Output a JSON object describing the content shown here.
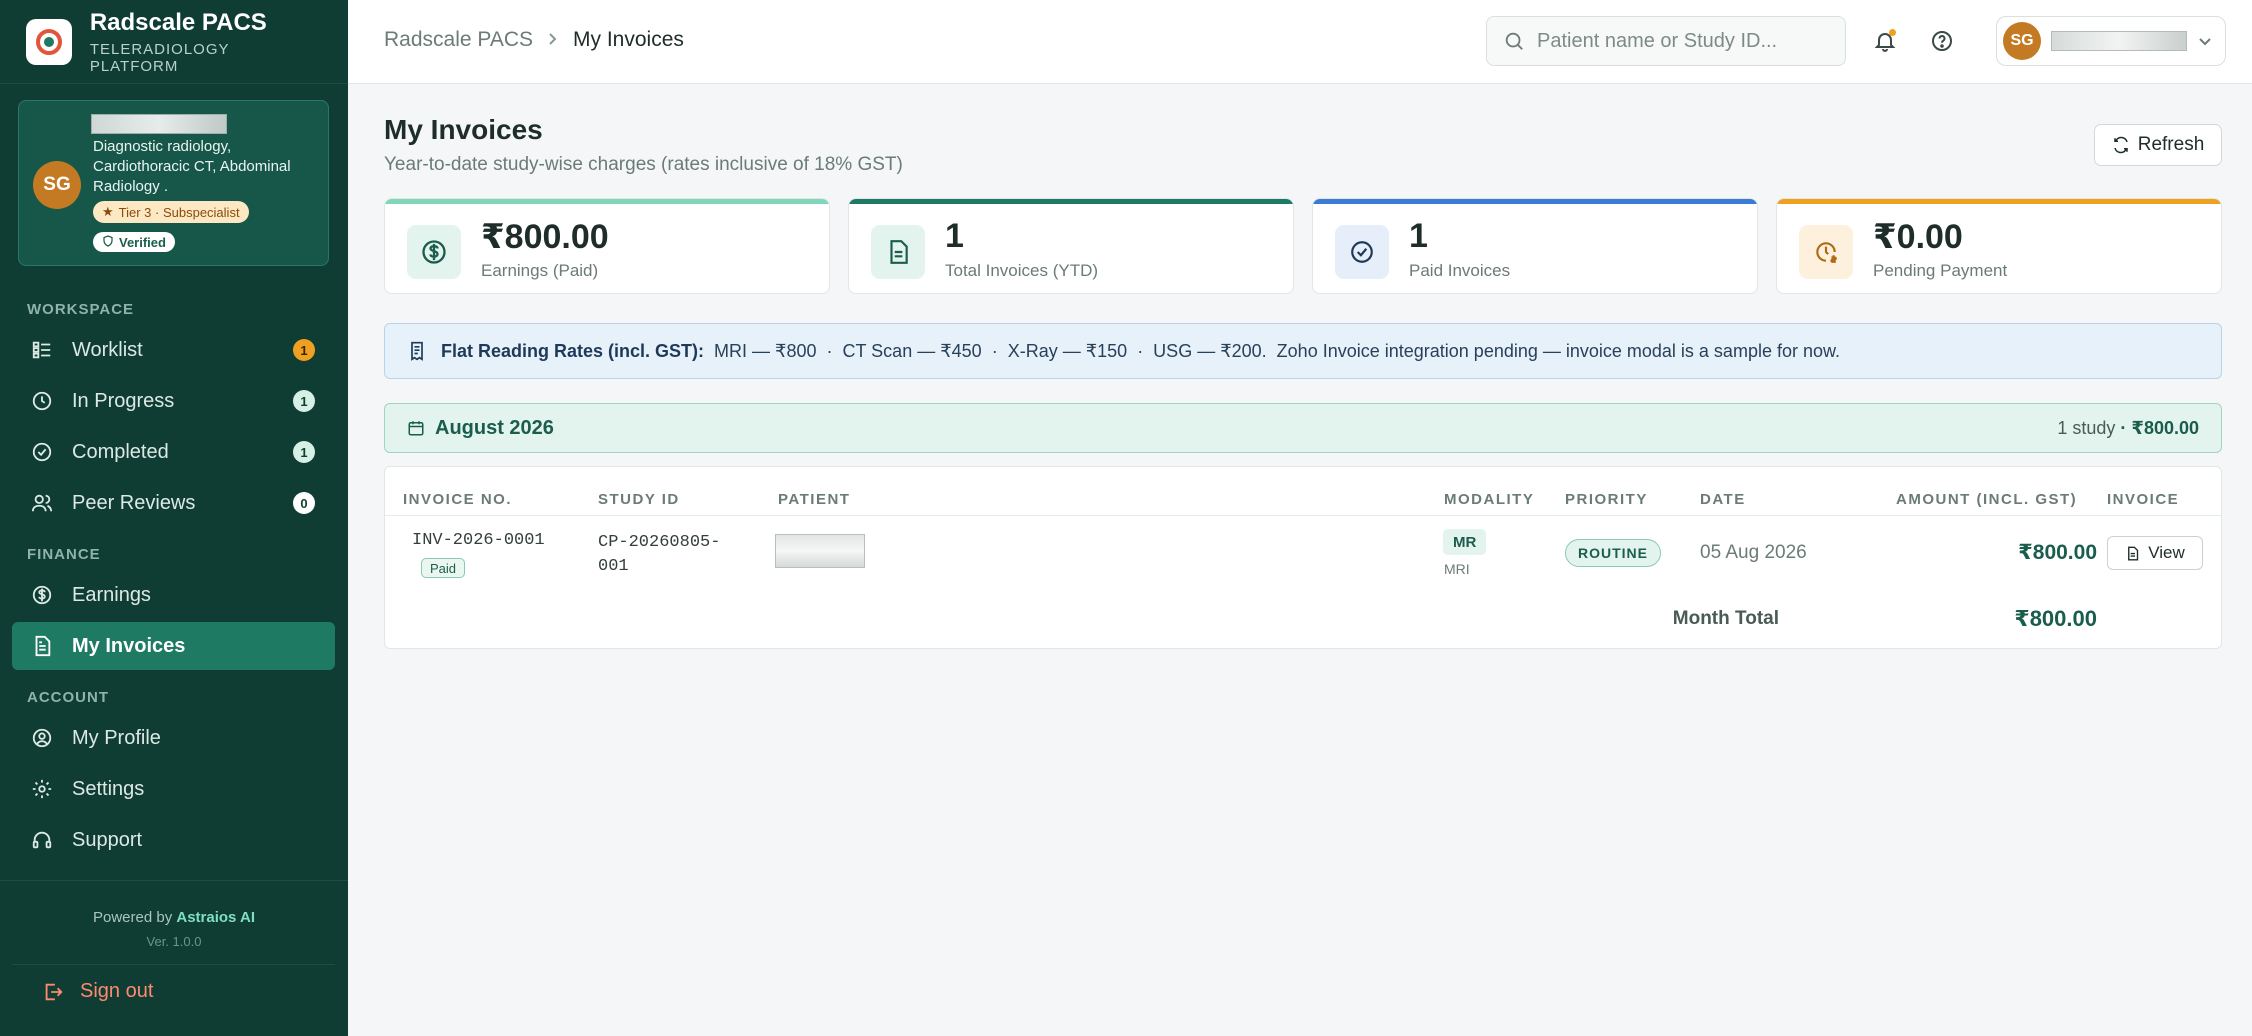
{
  "brand": {
    "title": "Radscale PACS",
    "subtitle": "TELERADIOLOGY PLATFORM"
  },
  "profile": {
    "initials": "SG",
    "specialty": "Diagnostic radiology, Cardiothoracic CT, Abdominal Radiology .",
    "tier": "Tier 3 · Subspecialist",
    "verified": "Verified"
  },
  "nav": {
    "workspace_label": "WORKSPACE",
    "finance_label": "FINANCE",
    "account_label": "ACCOUNT",
    "items": [
      {
        "label": "Worklist",
        "badge": "1"
      },
      {
        "label": "In Progress",
        "badge": "1"
      },
      {
        "label": "Completed",
        "badge": "1"
      },
      {
        "label": "Peer Reviews",
        "badge": "0"
      },
      {
        "label": "Earnings"
      },
      {
        "label": "My Invoices"
      },
      {
        "label": "My Profile"
      },
      {
        "label": "Settings"
      },
      {
        "label": "Support"
      }
    ]
  },
  "footer": {
    "powered_prefix": "Powered by",
    "powered_brand": "Astraios AI",
    "version": "Ver. 1.0.0",
    "signout": "Sign out"
  },
  "breadcrumb": {
    "root": "Radscale PACS",
    "current": "My Invoices"
  },
  "search": {
    "placeholder": "Patient name or Study ID..."
  },
  "user": {
    "initials": "SG"
  },
  "page": {
    "title": "My Invoices",
    "subtitle": "Year-to-date study-wise charges (rates inclusive of 18% GST)",
    "refresh": "Refresh"
  },
  "stats": [
    {
      "value": "₹800.00",
      "label": "Earnings (Paid)"
    },
    {
      "value": "1",
      "label": "Total Invoices (YTD)"
    },
    {
      "value": "1",
      "label": "Paid Invoices"
    },
    {
      "value": "₹0.00",
      "label": "Pending Payment"
    }
  ],
  "rates": {
    "title": "Flat Reading Rates (incl. GST):",
    "text": "MRI — ₹800  ·  CT Scan — ₹450  ·  X-Ray — ₹150  ·  USG — ₹200.  Zoho Invoice integration pending — invoice modal is a sample for now."
  },
  "month": {
    "title": "August 2026",
    "count": "1 study",
    "total": "· ₹800.00"
  },
  "table": {
    "headers": [
      "INVOICE NO.",
      "STUDY ID",
      "PATIENT",
      "MODALITY",
      "PRIORITY",
      "DATE",
      "AMOUNT (INCL. GST)",
      "INVOICE"
    ],
    "rows": [
      {
        "invoice_no": "INV-2026-0001",
        "status": "Paid",
        "study_id_line1": "CP-20260805-",
        "study_id_line2": "001",
        "modality_code": "MR",
        "modality_name": "MRI",
        "priority": "ROUTINE",
        "date": "05 Aug 2026",
        "amount": "₹800.00",
        "action": "View"
      }
    ],
    "month_total_label": "Month Total",
    "month_total_value": "₹800.00"
  },
  "colors": {
    "sidebar": "#0f3d33",
    "accent": "#1f7a63",
    "stat_bars": [
      "#7fd6b8",
      "#1f7a63",
      "#3a7bd5",
      "#f0a020"
    ]
  }
}
